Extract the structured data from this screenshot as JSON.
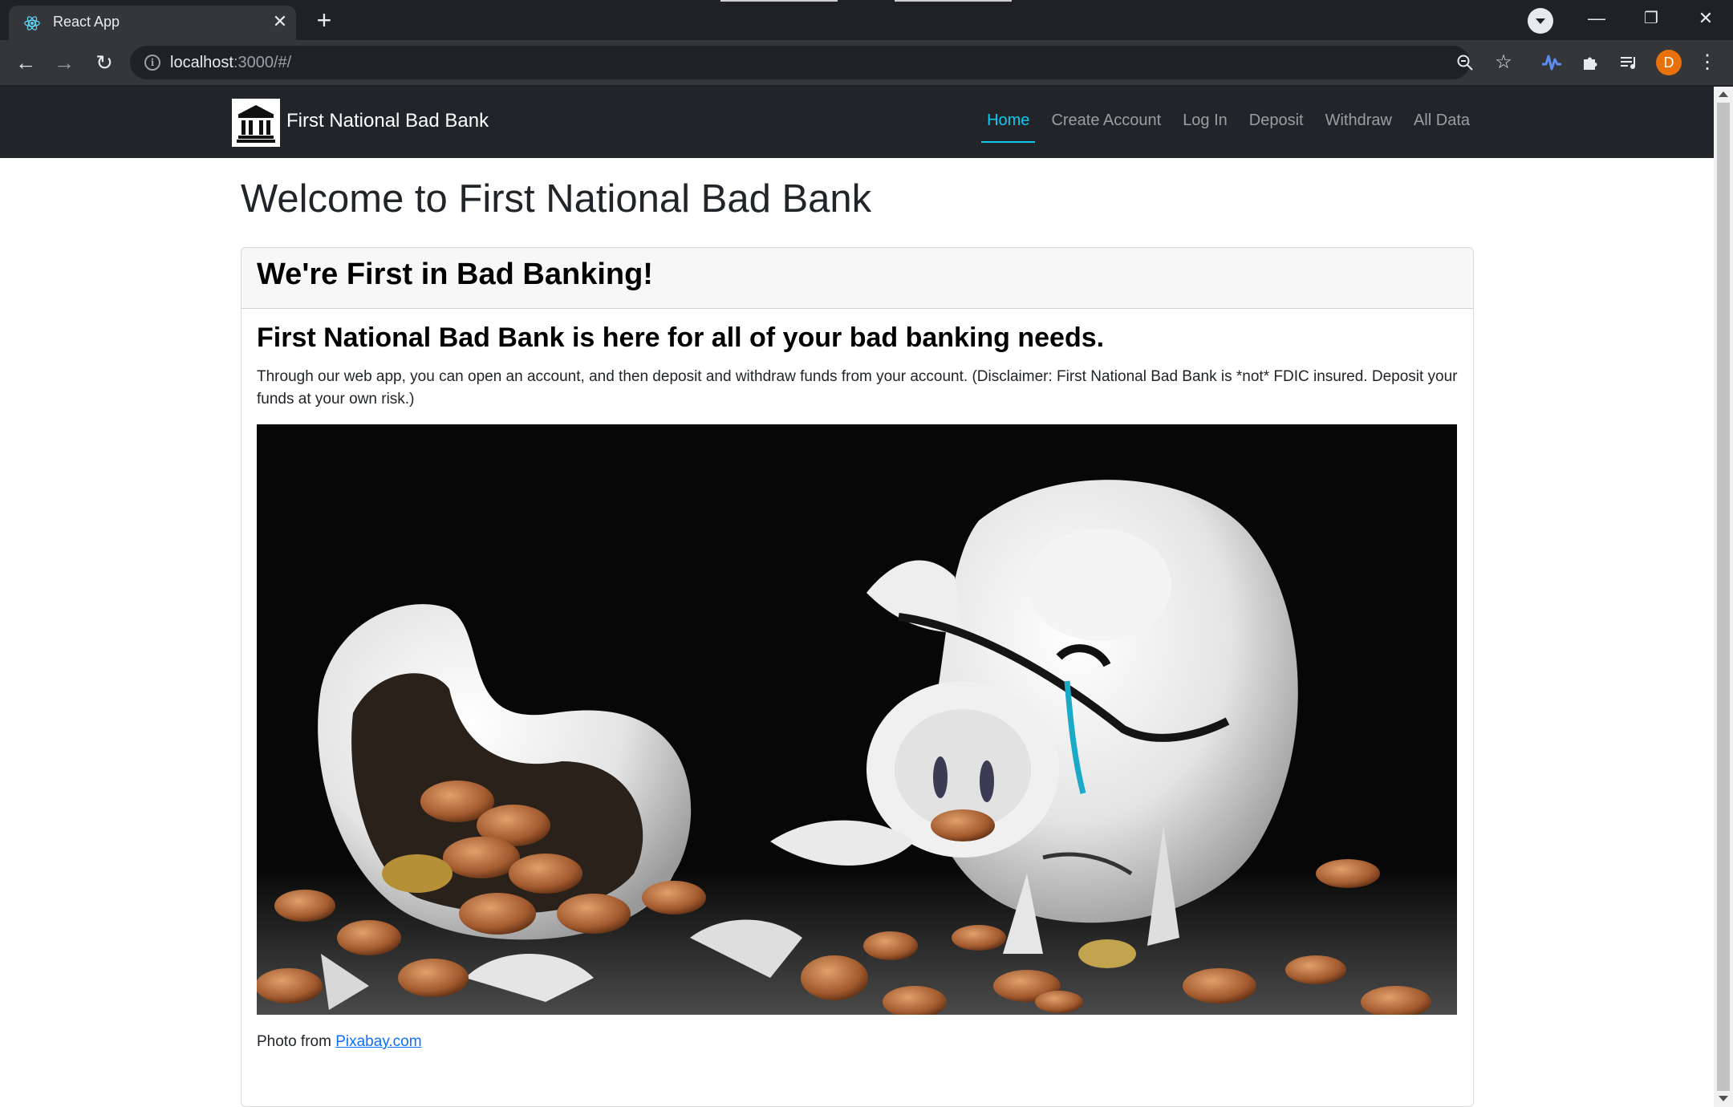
{
  "browser": {
    "tab_title": "React App",
    "url_host": "localhost",
    "url_path": ":3000/#/",
    "profile_initial": "D"
  },
  "site": {
    "brand": "First National Bad Bank",
    "nav": {
      "home": "Home",
      "create_account": "Create Account",
      "login": "Log In",
      "deposit": "Deposit",
      "withdraw": "Withdraw",
      "all_data": "All Data"
    },
    "active_nav": "Home"
  },
  "page": {
    "title": "Welcome to First National Bad Bank",
    "card": {
      "header": "We're First in Bad Banking!",
      "title": "First National Bad Bank is here for all of your bad banking needs.",
      "text": "Through our web app, you can open an account, and then deposit and withdraw funds from your account. (Disclaimer: First National Bad Bank is *not* FDIC insured. Deposit your funds at your own risk.)",
      "credit_prefix": "Photo from ",
      "credit_link": "Pixabay.com"
    }
  },
  "colors": {
    "navbar_bg": "#212529",
    "active_link": "#0dcaf0",
    "link": "#0d6efd",
    "avatar": "#e8710a"
  },
  "icons": {
    "favicon": "react-logo-icon",
    "logo": "bank-building-icon"
  }
}
